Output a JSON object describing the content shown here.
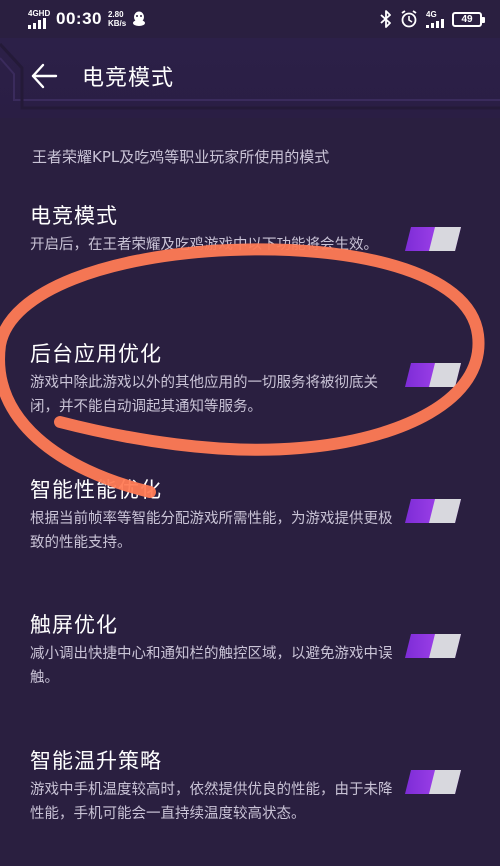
{
  "status_bar": {
    "network_label": "4GHD",
    "time": "00:30",
    "speed_value": "2.80",
    "speed_unit": "KB/s",
    "network_right": "4G",
    "battery": "49"
  },
  "header": {
    "title": "电竞模式"
  },
  "subtitle": "王者荣耀KPL及吃鸡等职业玩家所使用的模式",
  "settings": [
    {
      "title": "电竞模式",
      "description": "开启后，在王者荣耀及吃鸡游戏中以下功能将会生效。",
      "enabled": true
    },
    {
      "title": "后台应用优化",
      "description": "游戏中除此游戏以外的其他应用的一切服务将被彻底关闭，并不能自动调起其通知等服务。",
      "enabled": true
    },
    {
      "title": "智能性能优化",
      "description": "根据当前帧率等智能分配游戏所需性能，为游戏提供更极致的性能支持。",
      "enabled": true
    },
    {
      "title": "触屏优化",
      "description": "减小调出快捷中心和通知栏的触控区域，以避免游戏中误触。",
      "enabled": true
    },
    {
      "title": "智能温升策略",
      "description": "游戏中手机温度较高时，依然提供优良的性能，由于未降性能，手机可能会一直持续温度较高状态。",
      "enabled": true
    }
  ],
  "colors": {
    "background": "#2a1f40",
    "toggle_on": "#9b3df0",
    "annotation": "#ff7b55"
  }
}
